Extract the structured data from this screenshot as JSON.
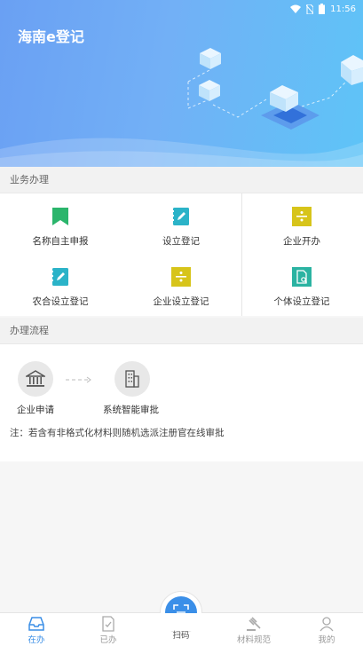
{
  "status_bar": {
    "time": "11:56"
  },
  "app": {
    "title": "海南e登记"
  },
  "sections": {
    "business": "业务办理",
    "process": "办理流程"
  },
  "business_items": [
    {
      "label": "名称自主申报",
      "icon": "bookmark-icon",
      "color": "#2bb56c"
    },
    {
      "label": "设立登记",
      "icon": "edit-note-icon",
      "color": "#2bb3c8"
    },
    {
      "label": "企业开办",
      "icon": "divide-icon",
      "color": "#d7c41a"
    },
    {
      "label": "农合设立登记",
      "icon": "edit-note-icon",
      "color": "#2bb3c8"
    },
    {
      "label": "企业设立登记",
      "icon": "divide-icon",
      "color": "#d7c41a"
    },
    {
      "label": "个体设立登记",
      "icon": "document-search-icon",
      "color": "#2bb3a2"
    }
  ],
  "process": {
    "steps": [
      {
        "label": "企业申请",
        "icon": "bank-icon"
      },
      {
        "label": "系统智能审批",
        "icon": "building-icon"
      }
    ],
    "note": "注：若含有非格式化材料则随机选派注册官在线审批"
  },
  "tabbar": {
    "tabs": [
      {
        "label": "在办",
        "icon": "inbox-icon",
        "active": true
      },
      {
        "label": "已办",
        "icon": "done-doc-icon",
        "active": false
      },
      {
        "label": "扫码",
        "icon": "scan-icon",
        "active": false
      },
      {
        "label": "材料规范",
        "icon": "gavel-icon",
        "active": false
      },
      {
        "label": "我的",
        "icon": "user-icon",
        "active": false
      }
    ]
  },
  "colors": {
    "accent": "#3a8ee6",
    "header_from": "#6aa0f3",
    "header_to": "#5ec4f7"
  }
}
